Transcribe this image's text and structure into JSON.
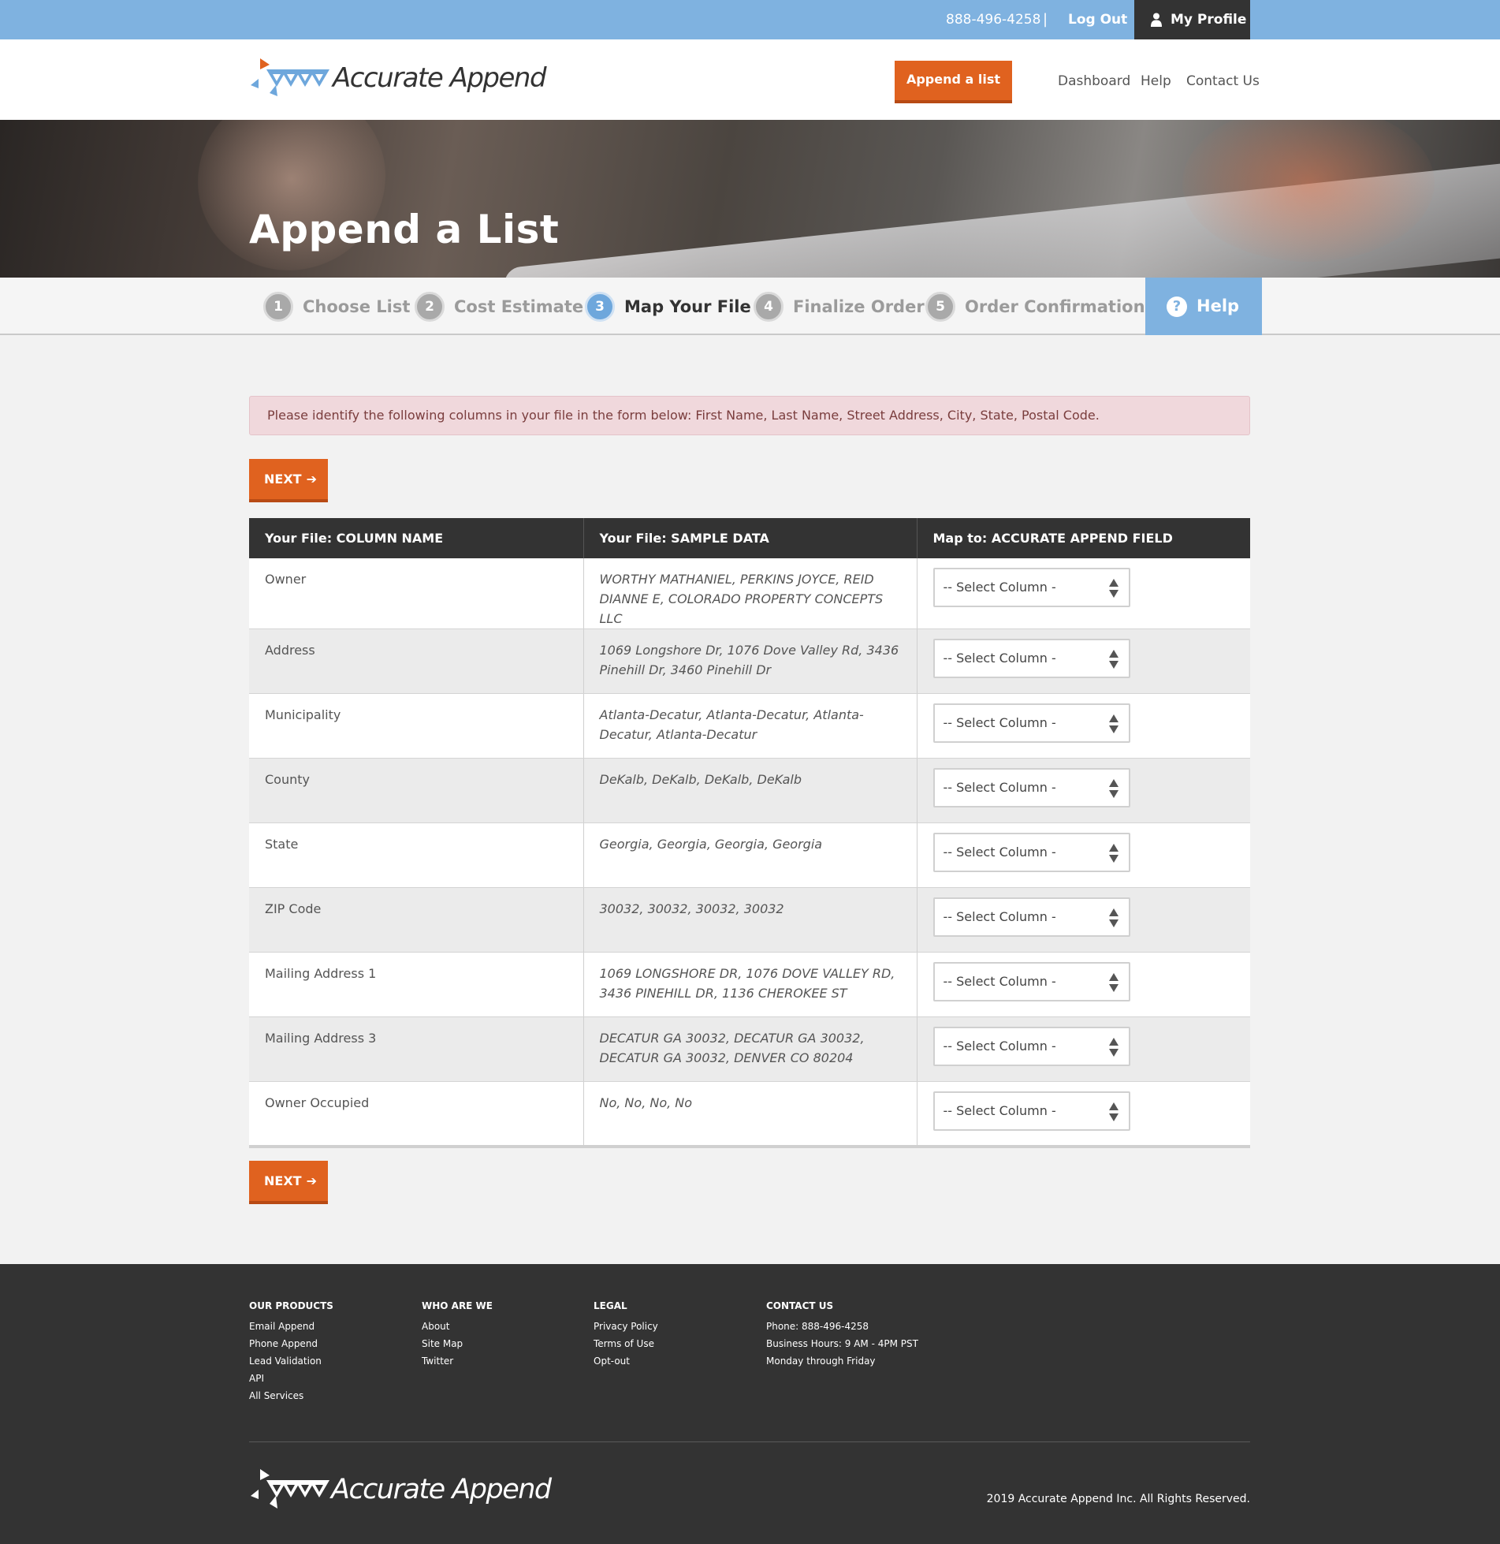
{
  "topbar": {
    "phone": "888-496-4258",
    "separator": "|",
    "logout": "Log Out",
    "profile": "My Profile"
  },
  "header": {
    "logo_text": "Accurate Append",
    "append_button": "Append a list",
    "nav": [
      "Dashboard",
      "Help",
      "Contact Us"
    ]
  },
  "hero": {
    "title": "Append a List"
  },
  "steps": [
    {
      "num": "1",
      "label": "Choose List",
      "active": false
    },
    {
      "num": "2",
      "label": "Cost Estimate",
      "active": false
    },
    {
      "num": "3",
      "label": "Map Your File",
      "active": true
    },
    {
      "num": "4",
      "label": "Finalize Order",
      "active": false
    },
    {
      "num": "5",
      "label": "Order Confirmation",
      "active": false
    }
  ],
  "help_tab": {
    "icon": "?",
    "label": "Help"
  },
  "alert": "Please identify the following columns in your file in the form below: First Name, Last Name, Street Address, City, State, Postal Code.",
  "next_button": "NEXT",
  "table": {
    "headers": [
      "Your File: COLUMN NAME",
      "Your File: SAMPLE DATA",
      "Map to: ACCURATE APPEND FIELD"
    ],
    "rows": [
      {
        "column": "Owner",
        "sample": "WORTHY MATHANIEL, PERKINS JOYCE, REID DIANNE E, COLORADO PROPERTY CONCEPTS LLC",
        "select": "-- Select Column -"
      },
      {
        "column": "Address",
        "sample": "1069 Longshore Dr, 1076 Dove Valley Rd, 3436 Pinehill Dr, 3460 Pinehill Dr",
        "select": "-- Select Column -"
      },
      {
        "column": "Municipality",
        "sample": "Atlanta-Decatur, Atlanta-Decatur, Atlanta-Decatur, Atlanta-Decatur",
        "select": "-- Select Column -"
      },
      {
        "column": "County",
        "sample": "DeKalb, DeKalb, DeKalb, DeKalb",
        "select": "-- Select Column -"
      },
      {
        "column": "State",
        "sample": "Georgia, Georgia, Georgia, Georgia",
        "select": "-- Select Column -"
      },
      {
        "column": "ZIP Code",
        "sample": "30032, 30032, 30032, 30032",
        "select": "-- Select Column -"
      },
      {
        "column": "Mailing Address 1",
        "sample": "1069 LONGSHORE DR, 1076 DOVE VALLEY RD, 3436 PINEHILL DR, 1136 CHEROKEE ST",
        "select": "-- Select Column -"
      },
      {
        "column": "Mailing Address 3",
        "sample": "DECATUR GA 30032, DECATUR GA 30032, DECATUR GA 30032, DENVER CO 80204",
        "select": "-- Select Column -"
      },
      {
        "column": "Owner Occupied",
        "sample": "No, No, No, No",
        "select": "-- Select Column -"
      }
    ]
  },
  "footer": {
    "columns": [
      {
        "heading": "OUR PRODUCTS",
        "links": [
          "Email Append",
          "Phone Append",
          "Lead Validation",
          "API",
          "All Services"
        ]
      },
      {
        "heading": "WHO ARE WE",
        "links": [
          "About",
          "Site Map",
          "Twitter"
        ]
      },
      {
        "heading": "LEGAL",
        "links": [
          "Privacy Policy",
          "Terms of Use",
          "Opt-out"
        ]
      },
      {
        "heading": "CONTACT US",
        "links": [
          "Phone: 888-496-4258",
          "Business Hours: 9 AM - 4PM PST",
          "Monday through Friday"
        ]
      }
    ],
    "logo_text": "Accurate Append",
    "copyright": "2019 Accurate Append Inc. All Rights Reserved."
  },
  "colors": {
    "topbar": "#7fb2e0",
    "accent_orange": "#e0621f",
    "dark": "#333333",
    "active_step": "#6ea7dc",
    "alert_bg": "#f0d8dc"
  }
}
